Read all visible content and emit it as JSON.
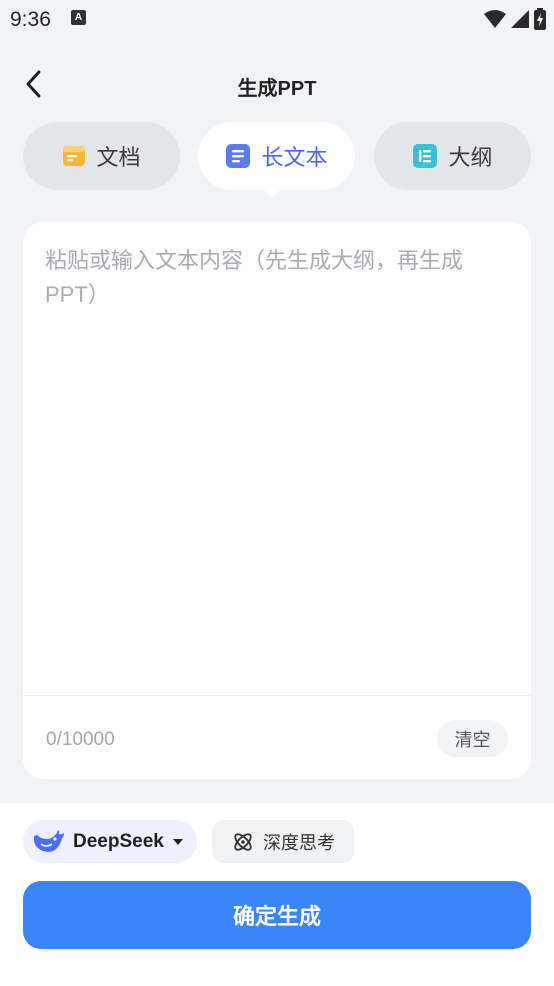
{
  "status_bar": {
    "time": "9:36",
    "notification_letter": "A",
    "icons": [
      "wifi-icon",
      "signal-icon",
      "battery-icon"
    ]
  },
  "header": {
    "title": "生成PPT",
    "back_icon": "chevron-left-icon"
  },
  "tabs": [
    {
      "label": "文档",
      "icon": "document-icon",
      "active": false
    },
    {
      "label": "长文本",
      "icon": "long-text-icon",
      "active": true
    },
    {
      "label": "大纲",
      "icon": "outline-icon",
      "active": false
    }
  ],
  "editor": {
    "placeholder": "粘贴或输入文本内容（先生成大纲，再生成PPT）",
    "value": "",
    "char_count": "0/10000",
    "clear_label": "清空"
  },
  "bottom": {
    "model_name": "DeepSeek",
    "model_icon": "deepseek-whale-icon",
    "deep_think_label": "深度思考",
    "deep_think_icon": "atom-icon",
    "confirm_label": "确定生成"
  },
  "colors": {
    "accent": "#3a86f9",
    "active_tab_text": "#4f62f0",
    "background": "#f2f3f6",
    "doc_icon": "#f7b73a",
    "long_text_icon": "#5b7bf5",
    "outline_icon": "#38c1d8",
    "deepseek_blue": "#4d6bfe"
  }
}
